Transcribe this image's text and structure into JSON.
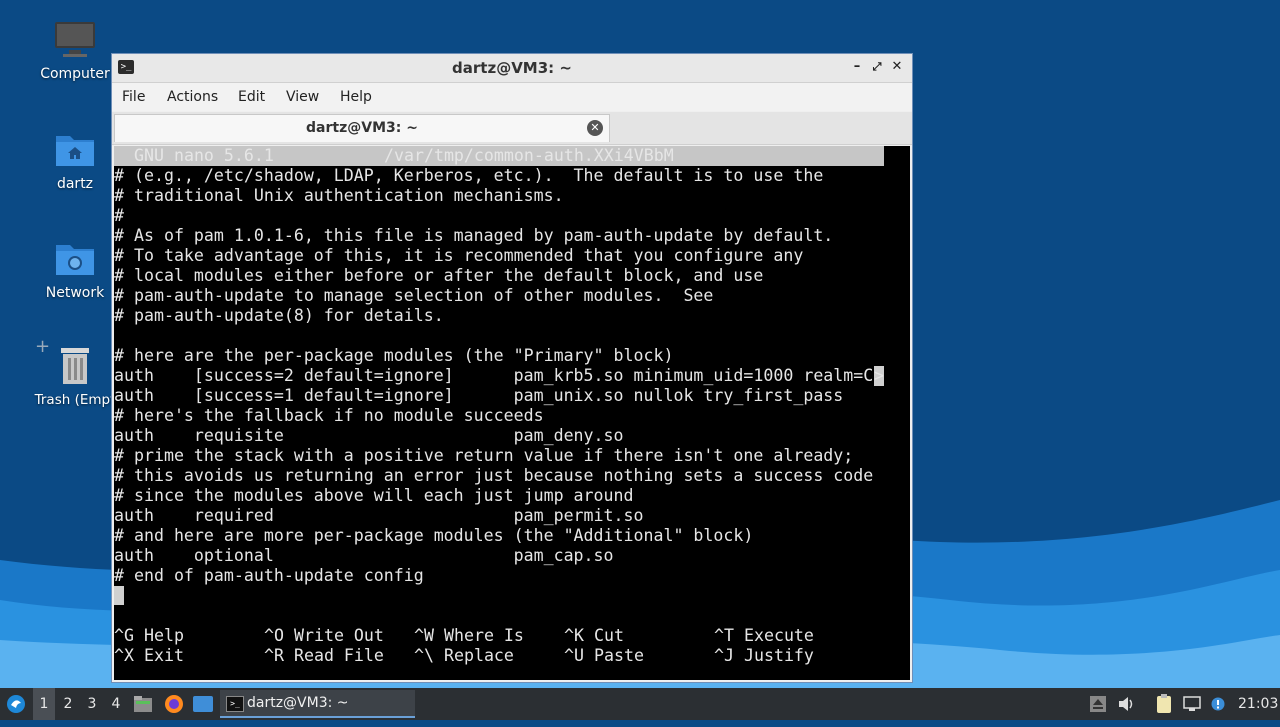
{
  "desktop": {
    "icons": [
      {
        "label": "Computer"
      },
      {
        "label": "dartz"
      },
      {
        "label": "Network"
      },
      {
        "label": "Trash (Empt"
      }
    ]
  },
  "window": {
    "title": "dartz@VM3: ~",
    "menu": [
      "File",
      "Actions",
      "Edit",
      "View",
      "Help"
    ],
    "tab_label": "dartz@VM3: ~"
  },
  "terminal": {
    "header_left": "GNU nano 5.6.1",
    "header_file": "/var/tmp/common-auth.XXi4VBbM",
    "lines": [
      {
        "text": "# (e.g., /etc/shadow, LDAP, Kerberos, etc.).  The default is to use the",
        "kind": "comment"
      },
      {
        "text": "# traditional Unix authentication mechanisms.",
        "kind": "comment"
      },
      {
        "text": "#",
        "kind": "comment"
      },
      {
        "text": "# As of pam 1.0.1-6, this file is managed by pam-auth-update by default.",
        "kind": "comment"
      },
      {
        "text": "# To take advantage of this, it is recommended that you configure any",
        "kind": "comment"
      },
      {
        "text": "# local modules either before or after the default block, and use",
        "kind": "comment"
      },
      {
        "text": "# pam-auth-update to manage selection of other modules.  See",
        "kind": "comment"
      },
      {
        "text": "# pam-auth-update(8) for details.",
        "kind": "comment"
      },
      {
        "text": "",
        "kind": "plain"
      },
      {
        "text": "# here are the per-package modules (the \"Primary\" block)",
        "kind": "comment"
      },
      {
        "text": "auth    [success=2 default=ignore]      pam_krb5.so minimum_uid=1000 realm=C",
        "kind": "plain",
        "overflow": ">"
      },
      {
        "text": "auth    [success=1 default=ignore]      pam_unix.so nullok try_first_pass",
        "kind": "plain"
      },
      {
        "text": "# here's the fallback if no module succeeds",
        "kind": "comment"
      },
      {
        "text": "auth    requisite                       pam_deny.so",
        "kind": "plain"
      },
      {
        "text": "# prime the stack with a positive return value if there isn't one already;",
        "kind": "comment"
      },
      {
        "text": "# this avoids us returning an error just because nothing sets a success code",
        "kind": "comment"
      },
      {
        "text": "# since the modules above will each just jump around",
        "kind": "comment"
      },
      {
        "text": "auth    required                        pam_permit.so",
        "kind": "plain"
      },
      {
        "text": "# and here are more per-package modules (the \"Additional\" block)",
        "kind": "comment"
      },
      {
        "text": "auth    optional                        pam_cap.so",
        "kind": "plain"
      },
      {
        "text": "# end of pam-auth-update config",
        "kind": "comment"
      }
    ],
    "shortcuts": [
      [
        {
          "key": "^G",
          "label": "Help"
        },
        {
          "key": "^O",
          "label": "Write Out"
        },
        {
          "key": "^W",
          "label": "Where Is"
        },
        {
          "key": "^K",
          "label": "Cut"
        },
        {
          "key": "^T",
          "label": "Execute"
        }
      ],
      [
        {
          "key": "^X",
          "label": "Exit"
        },
        {
          "key": "^R",
          "label": "Read File"
        },
        {
          "key": "^\\",
          "label": "Replace"
        },
        {
          "key": "^U",
          "label": "Paste"
        },
        {
          "key": "^J",
          "label": "Justify"
        }
      ]
    ]
  },
  "taskbar": {
    "workspaces": [
      "1",
      "2",
      "3",
      "4"
    ],
    "active_workspace": "1",
    "task_label": "dartz@VM3: ~",
    "clock": "21:03"
  }
}
